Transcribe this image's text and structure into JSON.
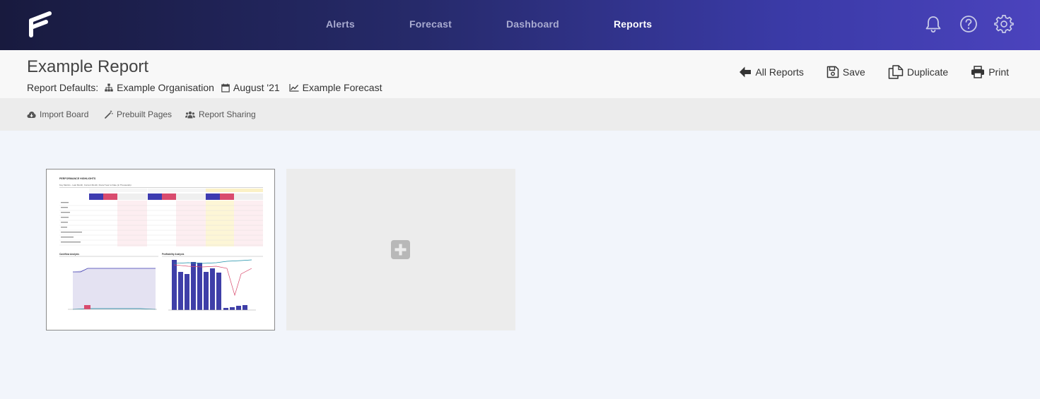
{
  "nav": {
    "items": [
      {
        "label": "Alerts",
        "active": false
      },
      {
        "label": "Forecast",
        "active": false
      },
      {
        "label": "Dashboard",
        "active": false
      },
      {
        "label": "Reports",
        "active": true
      }
    ],
    "icons": [
      "bell-icon",
      "help-icon",
      "gear-icon"
    ]
  },
  "header": {
    "title": "Example Report",
    "defaults_label": "Report Defaults:",
    "organisation": "Example Organisation",
    "period": "August '21",
    "forecast": "Example Forecast",
    "actions": {
      "all_reports": "All Reports",
      "save": "Save",
      "duplicate": "Duplicate",
      "print": "Print"
    }
  },
  "toolbar": {
    "import_board": "Import Board",
    "prebuilt_pages": "Prebuilt Pages",
    "report_sharing": "Report Sharing"
  },
  "pages": {
    "thumbnail": {
      "heading": "PERFORMANCE HIGHLIGHTS",
      "subheading": "Key Metrics - Last Month, Current Month, Fiscal Year to Date (in Thousands)",
      "left_chart_title": "Cashflow Analysis",
      "right_chart_title": "Profitability Analysis"
    }
  },
  "colors": {
    "accent": "#3d3bb0",
    "nav_gradient_start": "#181a3e",
    "nav_gradient_end": "#4b43bd",
    "loss_red": "#d94b6e",
    "thumb_bar": "#3f3fa8"
  }
}
